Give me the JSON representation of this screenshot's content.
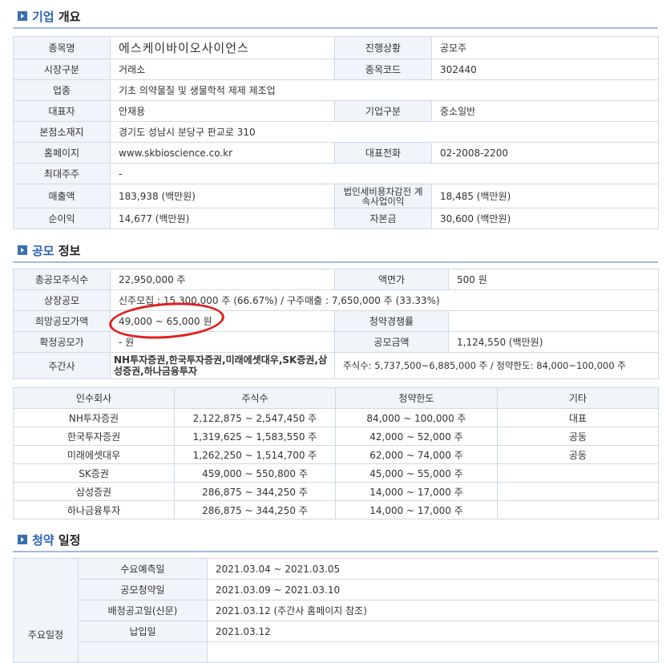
{
  "company": {
    "section_title_accent": "기업",
    "section_title_rest": " 개요",
    "rows": [
      {
        "l1": "종목명",
        "v1": "에스케이바이오사이언스",
        "l2": "진행상황",
        "v2": "공모주"
      },
      {
        "l1": "시장구분",
        "v1": "거래소",
        "l2": "종목코드",
        "v2": "302440"
      },
      {
        "l1": "업종",
        "v1": "기초 의약물질 및 생물학적 제제 제조업"
      },
      {
        "l1": "대표자",
        "v1": "안재용",
        "l2": "기업구분",
        "v2": "중소일반"
      },
      {
        "l1": "본점소재지",
        "v1": "경기도 성남시 분당구 판교로 310"
      },
      {
        "l1": "홈페이지",
        "v1": "www.skbioscience.co.kr",
        "l2": "대표전화",
        "v2": "02-2008-2200"
      },
      {
        "l1": "최대주주",
        "v1": "-"
      },
      {
        "l1": "매출액",
        "v1": "183,938 (백만원)",
        "l2": "법인세비용차감전 계속사업이익",
        "v2": "18,485 (백만원)"
      },
      {
        "l1": "순이익",
        "v1": "14,677 (백만원)",
        "l2": "자본금",
        "v2": "30,600 (백만원)"
      }
    ]
  },
  "offering": {
    "section_title_accent": "공모",
    "section_title_rest": " 정보",
    "rows": [
      {
        "l1": "총공모주식수",
        "v1": "22,950,000 주",
        "l2": "액면가",
        "v2": "500 원"
      },
      {
        "l1": "상장공모",
        "v1": "신주모집 : 15,300,000 주 (66.67%)   /    구주매출 : 7,650,000 주 (33.33%)"
      },
      {
        "l1": "희망공모가액",
        "v1": "49,000 ~ 65,000 원",
        "l2": "청약경쟁률",
        "v2": ""
      },
      {
        "l1": "확정공모가",
        "v1": "- 원",
        "l2": "공모금액",
        "v2": "1,124,550 (백만원)"
      },
      {
        "l1": "주간사",
        "v1": "NH투자증권,한국투자증권,미래에셋대우,SK증권,삼성증권,하나금융투자",
        "v2": "주식수: 5,737,500~6,885,000 주   /   청약한도: 84,000~100,000 주"
      }
    ]
  },
  "underwriters": {
    "headers": [
      "인수회사",
      "주식수",
      "청약한도",
      "기타"
    ],
    "rows": [
      [
        "NH투자증권",
        "2,122,875 ~ 2,547,450 주",
        "84,000 ~ 100,000 주",
        "대표"
      ],
      [
        "한국투자증권",
        "1,319,625 ~ 1,583,550 주",
        "42,000 ~ 52,000 주",
        "공동"
      ],
      [
        "미래에셋대우",
        "1,262,250 ~ 1,514,700 주",
        "62,000 ~ 74,000 주",
        "공동"
      ],
      [
        "SK증권",
        "459,000 ~ 550,800 주",
        "45,000 ~ 55,000 주",
        ""
      ],
      [
        "삼성증권",
        "286,875 ~ 344,250 주",
        "14,000 ~ 17,000 주",
        ""
      ],
      [
        "하나금융투자",
        "286,875 ~ 344,250 주",
        "14,000 ~ 17,000 주",
        ""
      ]
    ]
  },
  "schedule": {
    "section_title_accent": "청약",
    "section_title_rest": " 일정",
    "group_label": "주요일정",
    "rows": [
      {
        "label": "수요예측일",
        "value": "2021.03.04   ~    2021.03.05"
      },
      {
        "label": "공모청약일",
        "value": "2021.03.09   ~    2021.03.10"
      },
      {
        "label": "배정공고일(신문)",
        "value": "2021.03.12 (주간사 홈페이지 참조)"
      },
      {
        "label": "납입일",
        "value": "2021.03.12"
      }
    ]
  },
  "colors": {
    "accent": "#2b63b4",
    "circle": "#e0201f",
    "label_bg": "#f1f4f8",
    "border": "#cfd9e6"
  }
}
